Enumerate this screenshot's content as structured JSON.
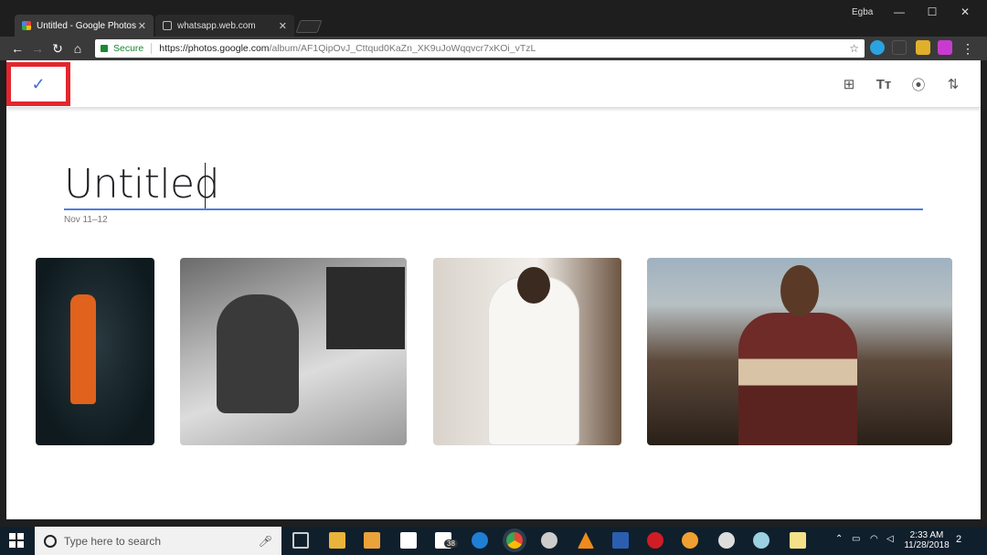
{
  "browser": {
    "user": "Egba",
    "tabs": [
      {
        "title": "Untitled - Google Photos",
        "close": "✕"
      },
      {
        "title": "whatsapp.web.com",
        "close": "✕"
      }
    ],
    "window_controls": {
      "minimize": "—",
      "maximize": "☐",
      "close": "✕"
    },
    "nav": {
      "back": "←",
      "forward": "→",
      "reload": "↻",
      "home": "⌂"
    },
    "omnibox": {
      "secure_label": "Secure",
      "url_host": "https://photos.google.com",
      "url_path": "/album/AF1QipOvJ_Cttqud0KaZn_XK9uJoWqqvcr7xKOi_vTzL",
      "star": "☆"
    },
    "menu": "⋮"
  },
  "app": {
    "confirm_icon": "✓",
    "tools": [
      {
        "name": "add-photos-icon",
        "glyph": "⊞"
      },
      {
        "name": "text-icon",
        "glyph": "Tт"
      },
      {
        "name": "location-icon",
        "glyph": "⦿"
      },
      {
        "name": "sort-icon",
        "glyph": "⇅"
      }
    ],
    "album": {
      "title": "Untitled",
      "dates": "Nov 11–12"
    },
    "colors": {
      "accent": "#4a7fe0",
      "highlight": "#e3262d"
    }
  },
  "taskbar": {
    "search_placeholder": "Type here to search",
    "mail_badge": "38",
    "time": "2:33 AM",
    "date": "11/28/2018",
    "notifications": "2"
  }
}
